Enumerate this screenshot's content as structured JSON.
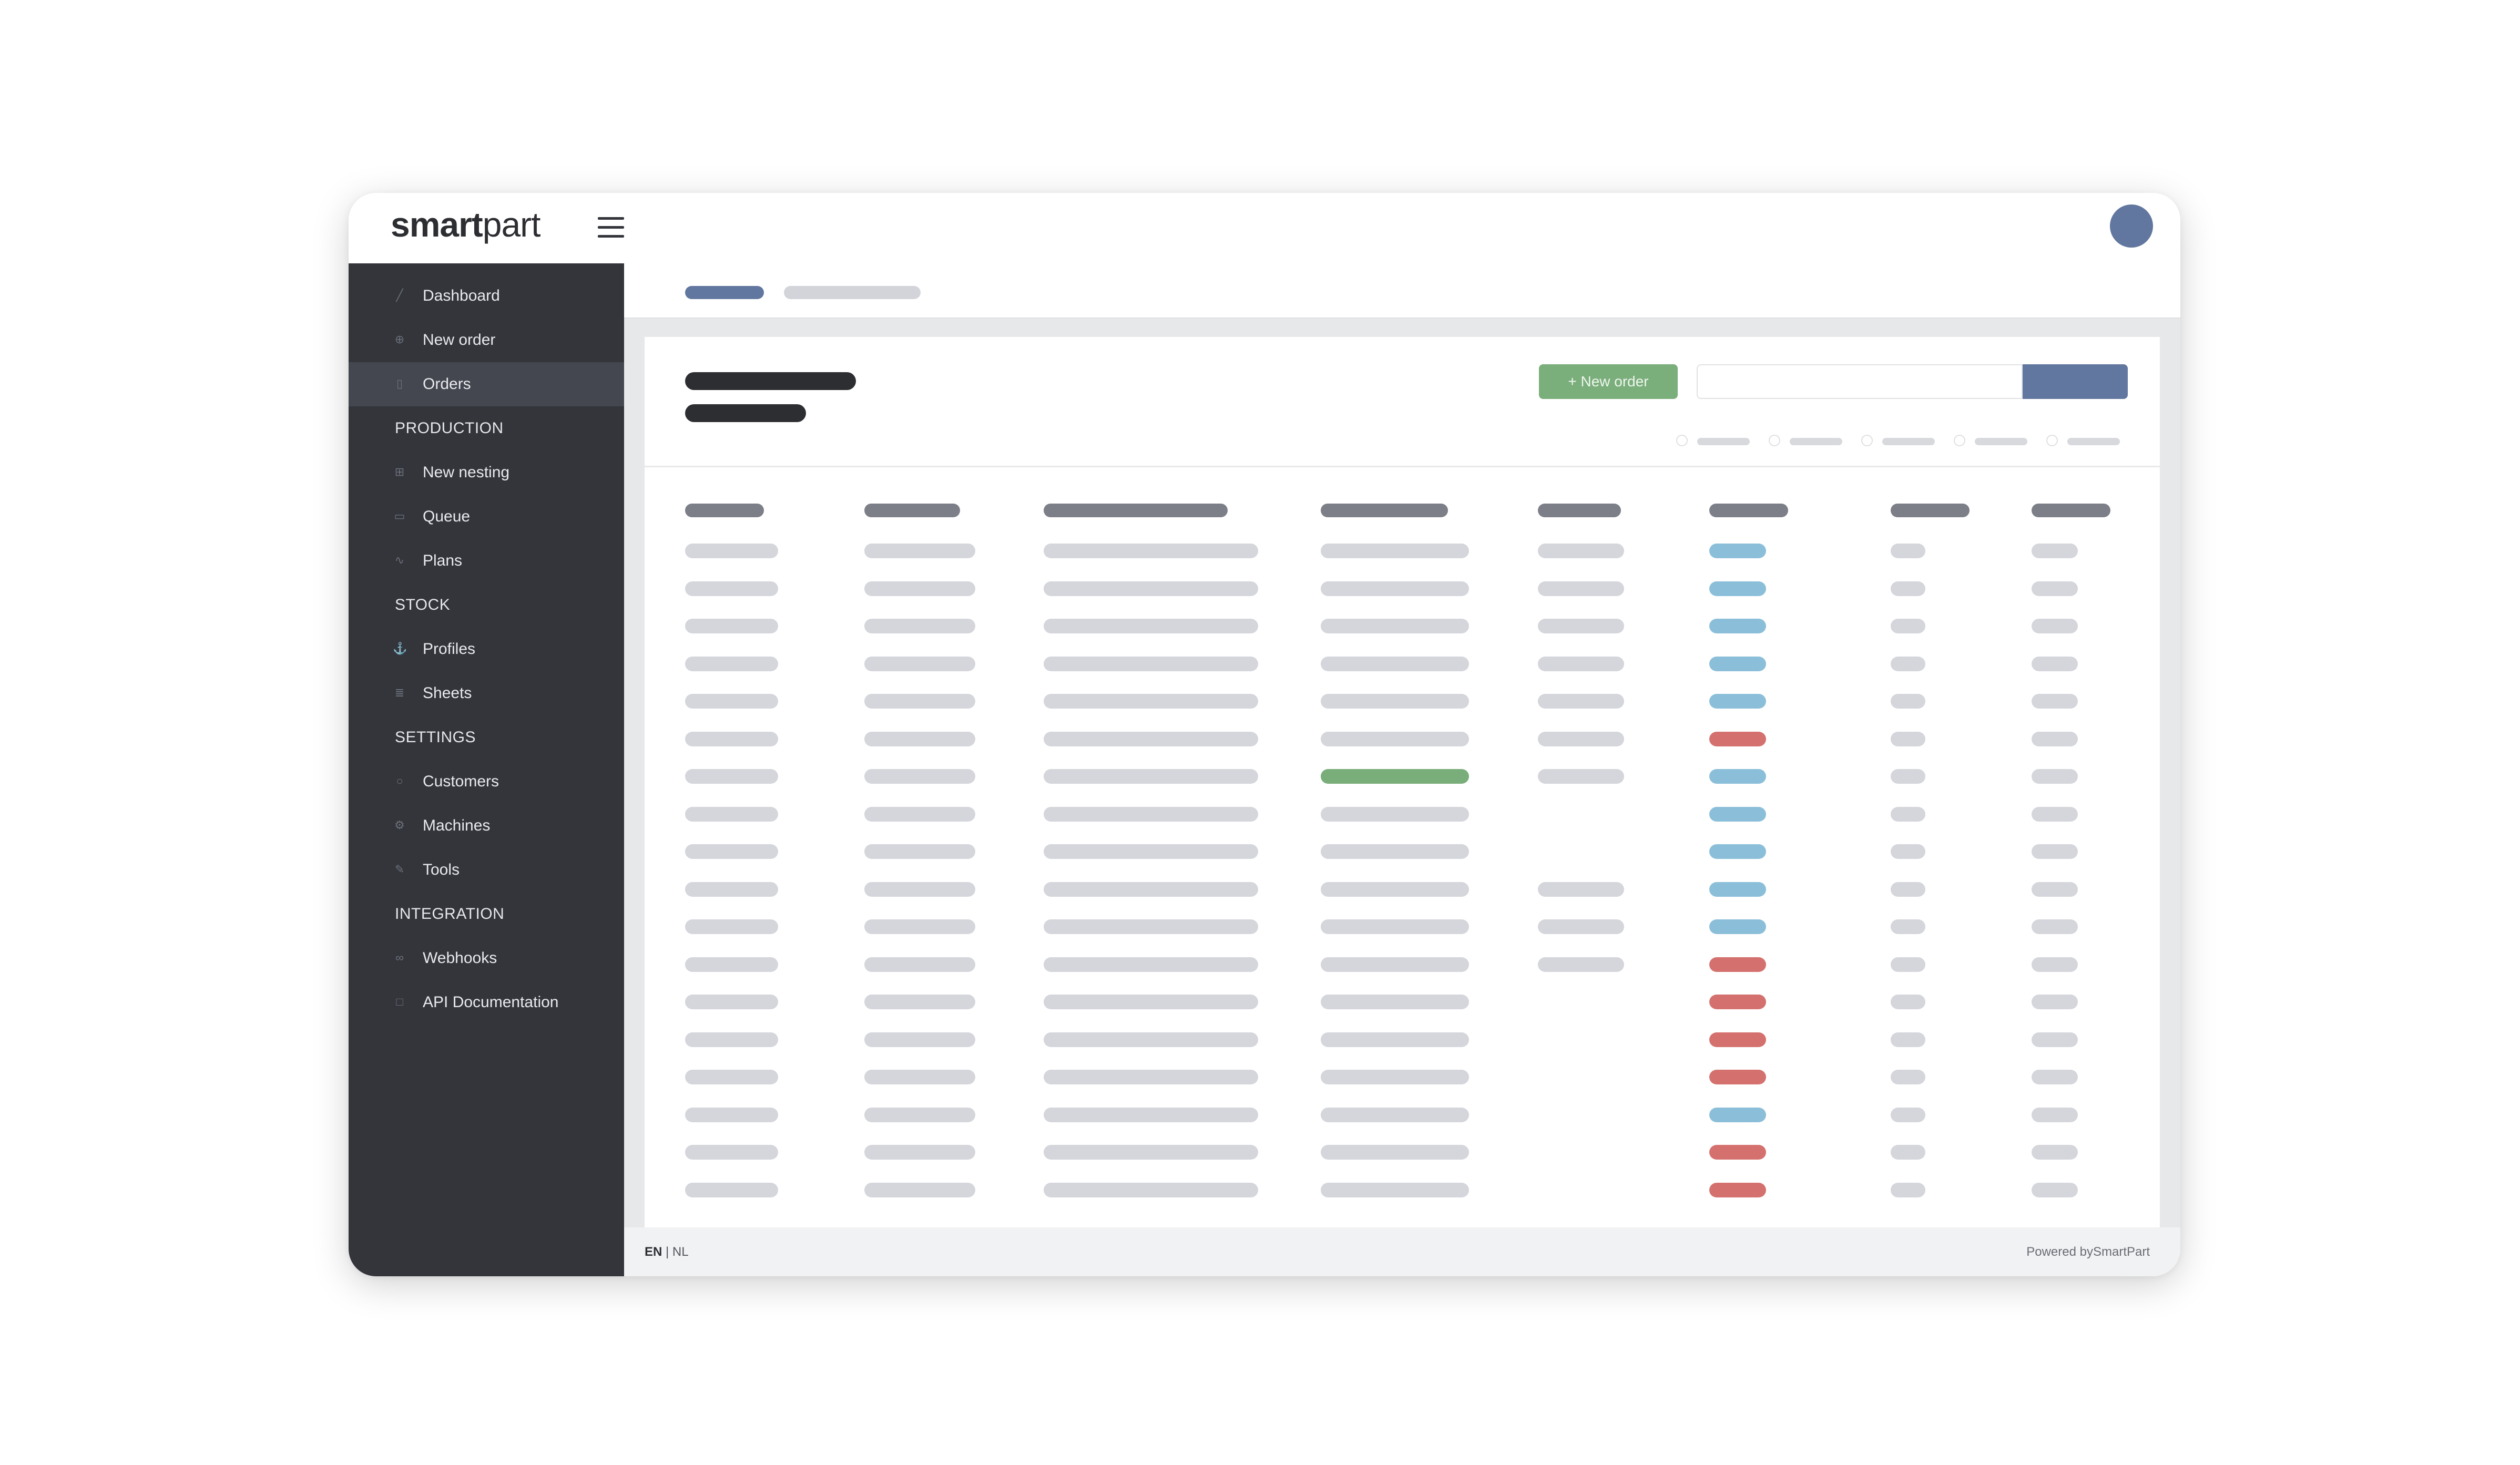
{
  "app": {
    "logo_bold": "smart",
    "logo_light": "part"
  },
  "sidebar": {
    "items": [
      {
        "label": "Dashboard",
        "icon": "chart-icon",
        "glyph": "╱"
      },
      {
        "label": "New order",
        "icon": "plus-circle-icon",
        "glyph": "⊕"
      },
      {
        "label": "Orders",
        "icon": "document-icon",
        "glyph": "▯",
        "active": true
      },
      {
        "section": "PRODUCTION"
      },
      {
        "label": "New nesting",
        "icon": "add-square-icon",
        "glyph": "⊞"
      },
      {
        "label": "Queue",
        "icon": "truck-icon",
        "glyph": "▭"
      },
      {
        "label": "Plans",
        "icon": "pulse-icon",
        "glyph": "∿"
      },
      {
        "section": "STOCK"
      },
      {
        "label": "Profiles",
        "icon": "anchor-icon",
        "glyph": "⚓"
      },
      {
        "label": "Sheets",
        "icon": "layers-icon",
        "glyph": "≣"
      },
      {
        "section": "SETTINGS"
      },
      {
        "label": "Customers",
        "icon": "user-icon",
        "glyph": "○"
      },
      {
        "label": "Machines",
        "icon": "gears-icon",
        "glyph": "⚙"
      },
      {
        "label": "Tools",
        "icon": "pencil-icon",
        "glyph": "✎"
      },
      {
        "section": "INTEGRATION"
      },
      {
        "label": "Webhooks",
        "icon": "link-icon",
        "glyph": "∞"
      },
      {
        "label": "API Documentation",
        "icon": "book-icon",
        "glyph": "□"
      }
    ]
  },
  "toolbar": {
    "new_order_label": "+ New order"
  },
  "table": {
    "status_colors": {
      "grey": "#d4d6db",
      "blue": "#8bbfd9",
      "red": "#d4716e",
      "green": "#79ae7a"
    },
    "rows": [
      {
        "col5": true,
        "status": "blue",
        "col4_highlight": false
      },
      {
        "col5": true,
        "status": "blue",
        "col4_highlight": false
      },
      {
        "col5": true,
        "status": "blue",
        "col4_highlight": false
      },
      {
        "col5": true,
        "status": "blue",
        "col4_highlight": false
      },
      {
        "col5": true,
        "status": "blue",
        "col4_highlight": false
      },
      {
        "col5": true,
        "status": "red",
        "col4_highlight": false
      },
      {
        "col5": true,
        "status": "blue",
        "col4_highlight": true
      },
      {
        "col5": false,
        "status": "blue",
        "col4_highlight": false
      },
      {
        "col5": false,
        "status": "blue",
        "col4_highlight": false
      },
      {
        "col5": true,
        "status": "blue",
        "col4_highlight": false
      },
      {
        "col5": true,
        "status": "blue",
        "col4_highlight": false
      },
      {
        "col5": true,
        "status": "red",
        "col4_highlight": false
      },
      {
        "col5": false,
        "status": "red",
        "col4_highlight": false
      },
      {
        "col5": false,
        "status": "red",
        "col4_highlight": false
      },
      {
        "col5": false,
        "status": "red",
        "col4_highlight": false
      },
      {
        "col5": false,
        "status": "blue",
        "col4_highlight": false
      },
      {
        "col5": false,
        "status": "red",
        "col4_highlight": false
      },
      {
        "col5": false,
        "status": "red",
        "col4_highlight": false
      }
    ]
  },
  "footer": {
    "lang_en": "EN",
    "lang_sep": " | ",
    "lang_nl": "NL",
    "powered": "Powered bySmartPart"
  }
}
